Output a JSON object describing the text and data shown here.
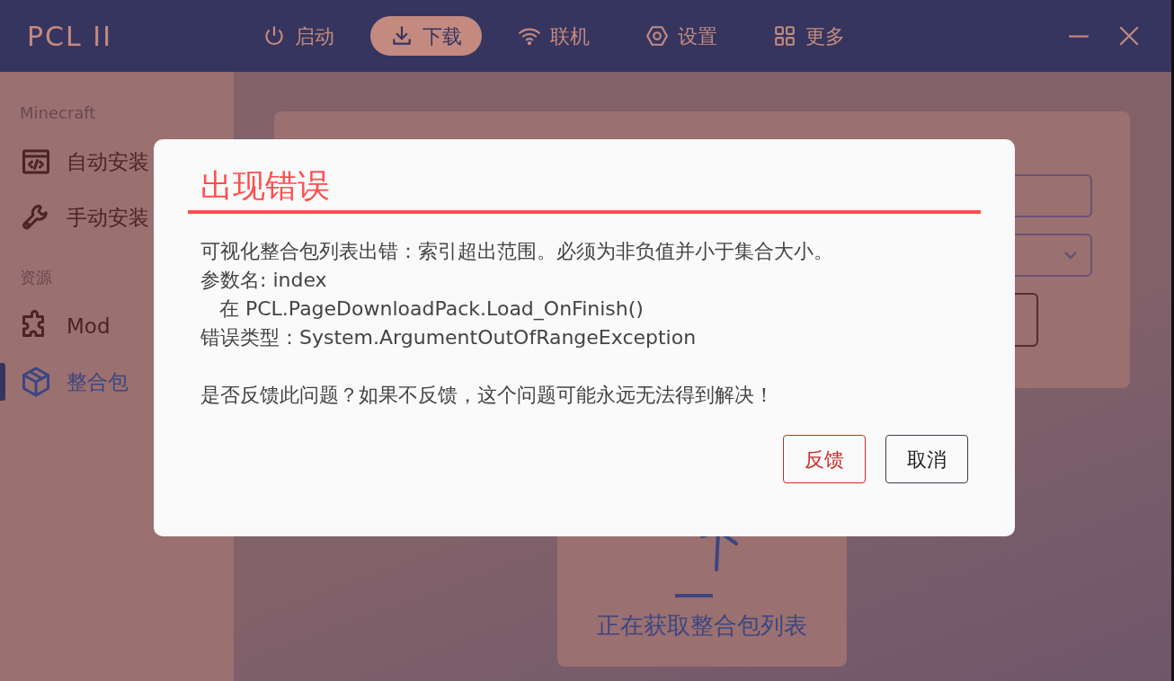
{
  "window": {
    "title": "PCL II"
  },
  "nav": [
    {
      "label": "启动",
      "selected": false
    },
    {
      "label": "下载",
      "selected": true
    },
    {
      "label": "联机",
      "selected": false
    },
    {
      "label": "设置",
      "selected": false
    },
    {
      "label": "更多",
      "selected": false
    }
  ],
  "sidebar": {
    "sections": [
      {
        "heading": "Minecraft",
        "items": [
          {
            "label": "自动安装",
            "selected": false
          },
          {
            "label": "手动安装",
            "selected": false
          }
        ]
      },
      {
        "heading": "资源",
        "items": [
          {
            "label": "Mod",
            "selected": false
          },
          {
            "label": "整合包",
            "selected": true
          }
        ]
      }
    ]
  },
  "loading": {
    "text": "正在获取整合包列表"
  },
  "dialog": {
    "title": "出现错误",
    "message_lines": [
      "可视化整合包列表出错：索引超出范围。必须为非负值并小于集合大小。",
      "参数名: index",
      "   在 PCL.PageDownloadPack.Load_OnFinish()",
      "错误类型：System.ArgumentOutOfRangeException"
    ],
    "question": "是否反馈此问题？如果不反馈，这个问题可能永远无法得到解决！",
    "buttons": [
      {
        "label": "反馈",
        "kind": "primary"
      },
      {
        "label": "取消",
        "kind": "secondary"
      }
    ]
  }
}
